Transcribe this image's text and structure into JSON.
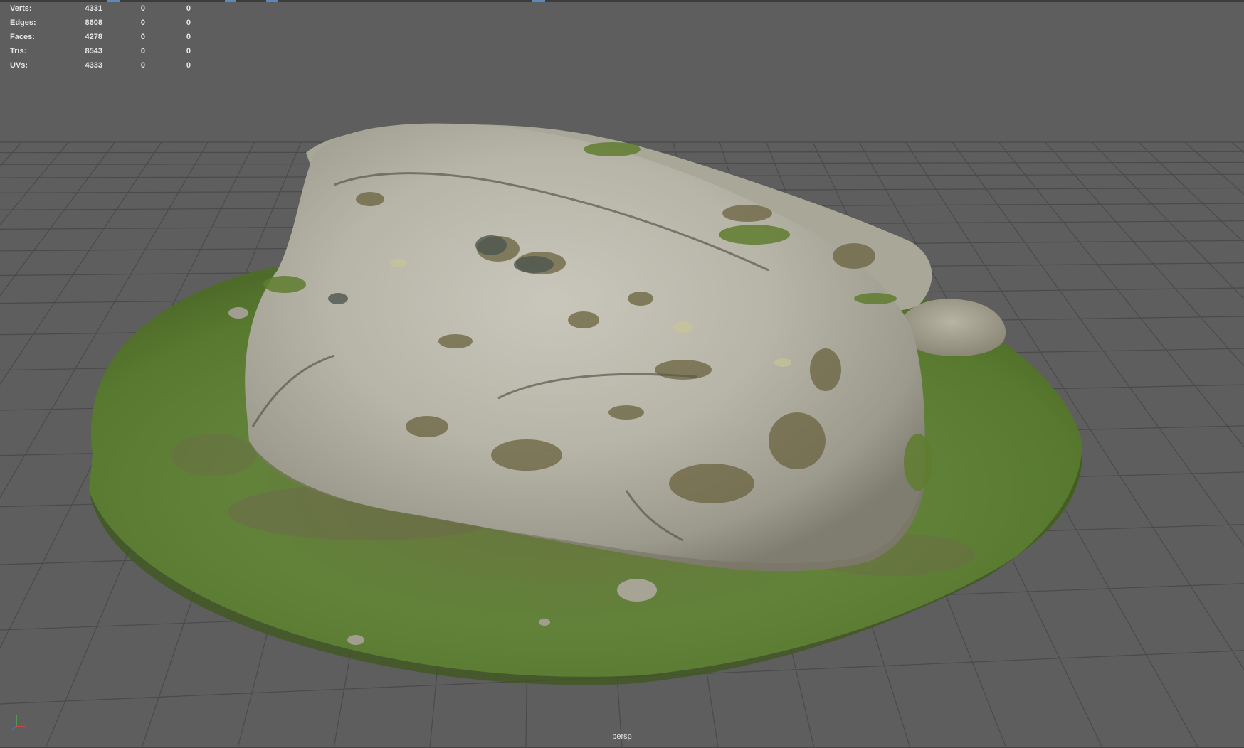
{
  "stats": {
    "rows": [
      {
        "label": "Verts:",
        "v1": "4331",
        "v2": "0",
        "v3": "0"
      },
      {
        "label": "Edges:",
        "v1": "8608",
        "v2": "0",
        "v3": "0"
      },
      {
        "label": "Faces:",
        "v1": "4278",
        "v2": "0",
        "v3": "0"
      },
      {
        "label": "Tris:",
        "v1": "8543",
        "v2": "0",
        "v3": "0"
      },
      {
        "label": "UVs:",
        "v1": "4333",
        "v2": "0",
        "v3": "0"
      }
    ]
  },
  "camera": {
    "name": "persp"
  },
  "icons": {
    "axis_gizmo": "axis-gizmo-icon"
  },
  "colors": {
    "viewport_bg": "#5e5e5e",
    "grid": "#4a4a4a",
    "grass": "#5f7f35",
    "rock": "#b6b5a8",
    "lichen": "#6b6340",
    "hud_text": "#e8e8e8"
  }
}
